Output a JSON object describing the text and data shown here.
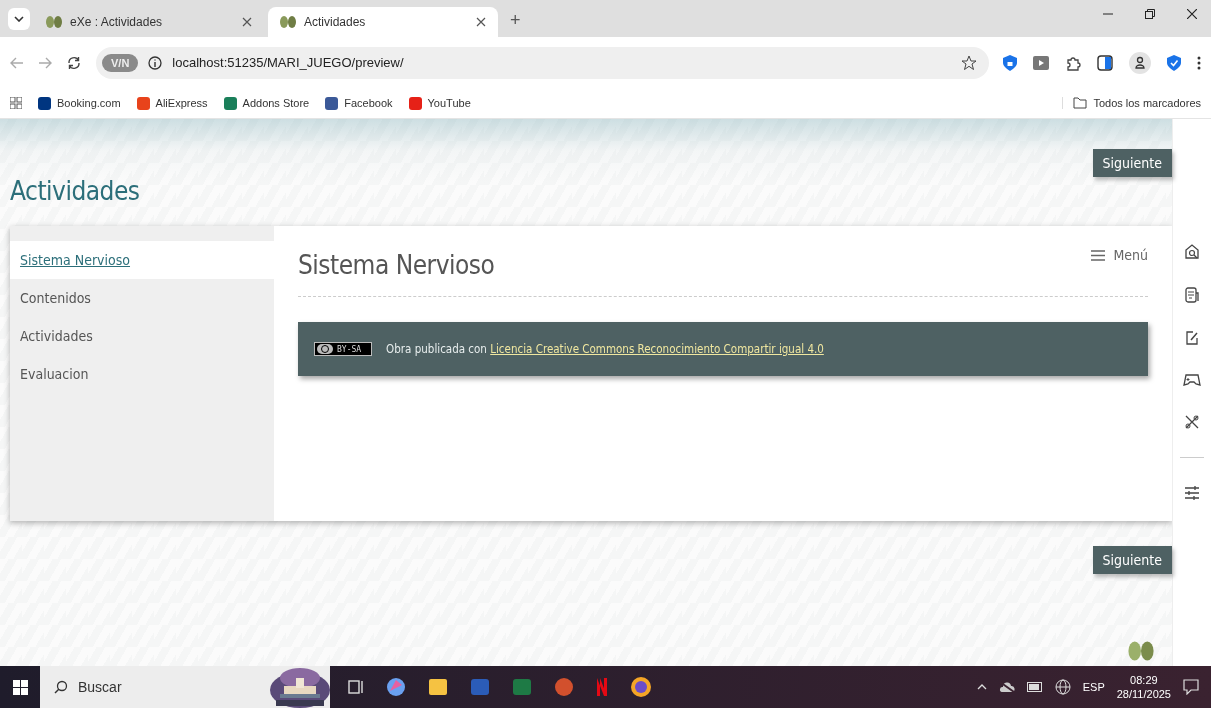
{
  "browser": {
    "tabs": [
      {
        "label": "eXe : Actividades",
        "selected": false
      },
      {
        "label": "Actividades",
        "selected": true
      }
    ],
    "new_tab": "+",
    "address": "localhost:51235/MARI_JUEGO/preview/",
    "vpn_badge": "V/N",
    "bookmarks": [
      {
        "label": "Booking.com",
        "color": "#003580"
      },
      {
        "label": "AliExpress",
        "color": "#e8431b"
      },
      {
        "label": "Addons Store",
        "color": "#1a7f5a"
      },
      {
        "label": "Facebook",
        "color": "#3b5998"
      },
      {
        "label": "YouTube",
        "color": "#e62117"
      }
    ],
    "all_bookmarks": "Todos los marcadores"
  },
  "page": {
    "site_title": "Actividades",
    "next_buttons": [
      "Siguiente",
      "Siguiente"
    ],
    "nav": [
      {
        "label": "Sistema Nervioso",
        "selected": true
      },
      {
        "label": "Contenidos",
        "selected": false
      },
      {
        "label": "Actividades",
        "selected": false
      },
      {
        "label": "Evaluacion",
        "selected": false
      }
    ],
    "heading": "Sistema Nervioso",
    "menu_label": "Menú",
    "license": {
      "badge": "BY-SA",
      "text": "Obra publicada con",
      "link": "Licencia Creative Commons Reconocimiento Compartir igual 4.0"
    }
  },
  "taskbar": {
    "search_placeholder": "Buscar",
    "language": "ESP",
    "time": "08:29",
    "date": "28/11/2025"
  }
}
